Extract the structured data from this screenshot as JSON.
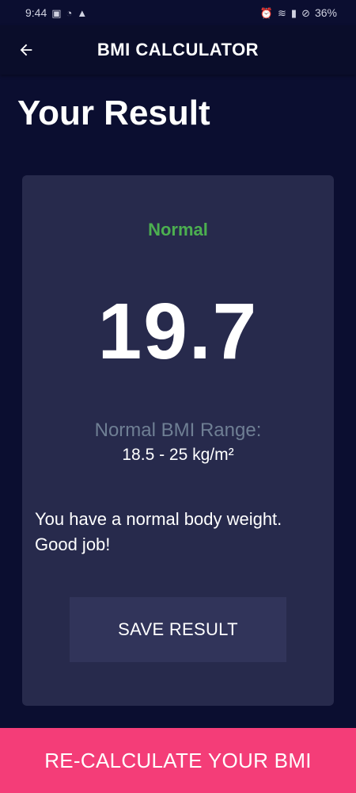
{
  "status_bar": {
    "time": "9:44",
    "battery": "36%",
    "icons_left": [
      "image-icon",
      "data-saver-icon",
      "warning-icon"
    ],
    "icons_right": [
      "alarm-icon",
      "wifi-icon",
      "signal-icon",
      "dnd-icon"
    ]
  },
  "app_bar": {
    "title": "BMI CALCULATOR",
    "back_icon": "arrow-back-icon"
  },
  "page": {
    "title": "Your Result"
  },
  "result": {
    "category": "Normal",
    "category_color": "#4caf50",
    "bmi": "19.7",
    "range_label": "Normal BMI Range:",
    "range_value": "18.5 - 25 kg/m²",
    "interpretation": "You have a normal body weight. Good job!",
    "save_label": "SAVE RESULT"
  },
  "bottom_button": {
    "label": "RE-CALCULATE YOUR BMI",
    "color": "#f43d78"
  },
  "colors": {
    "background": "#0b0e30",
    "card": "#272a4c",
    "button": "#31345a"
  }
}
